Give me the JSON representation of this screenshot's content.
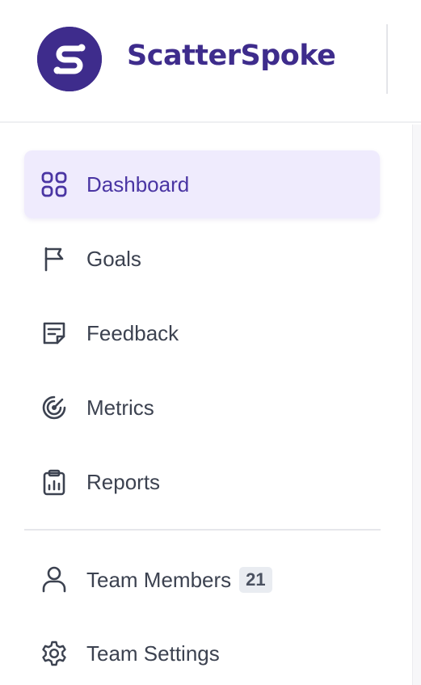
{
  "brand": {
    "name": "ScatterSpoke",
    "logo_icon": "scatterspoke-s-logo",
    "color": "#3e2c8c"
  },
  "nav": {
    "items": [
      {
        "label": "Dashboard",
        "icon": "grid-icon",
        "active": true
      },
      {
        "label": "Goals",
        "icon": "flag-icon",
        "active": false
      },
      {
        "label": "Feedback",
        "icon": "note-icon",
        "active": false
      },
      {
        "label": "Metrics",
        "icon": "target-icon",
        "active": false
      },
      {
        "label": "Reports",
        "icon": "clipboard-chart-icon",
        "active": false
      }
    ],
    "team_items": [
      {
        "label": "Team Members",
        "icon": "user-icon",
        "badge": "21"
      },
      {
        "label": "Team Settings",
        "icon": "gear-icon"
      }
    ]
  },
  "colors": {
    "active_bg": "#efebfd",
    "active_text": "#4a35a3",
    "text": "#3c4250"
  }
}
